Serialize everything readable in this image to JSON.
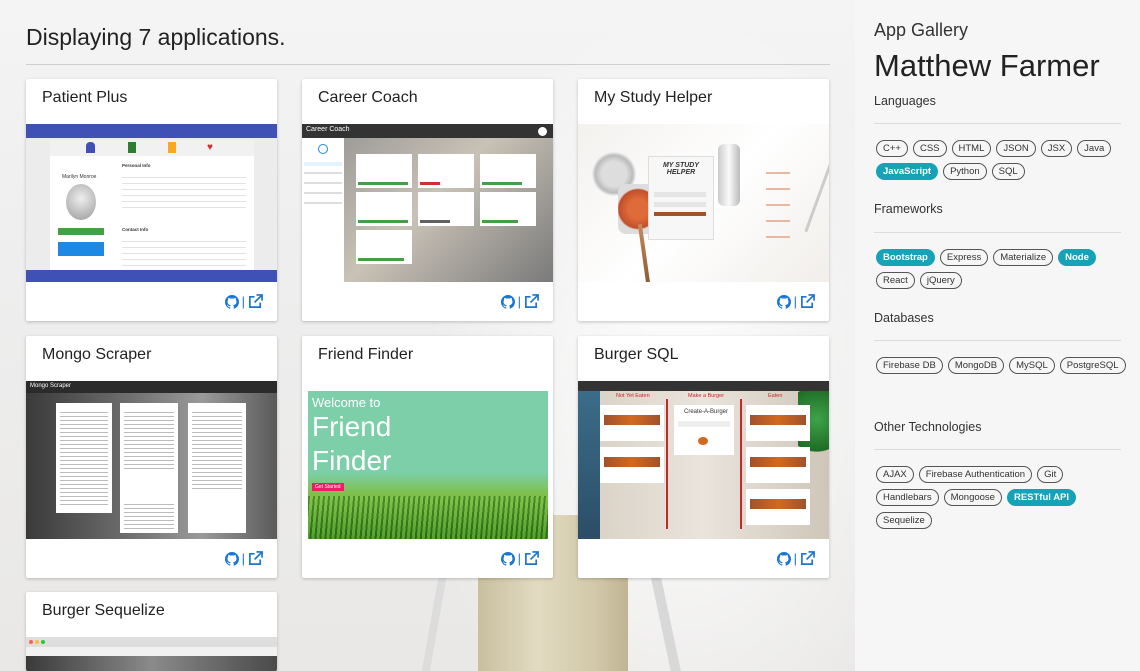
{
  "main": {
    "heading": "Displaying 7 applications."
  },
  "cards": [
    {
      "title": "Patient Plus",
      "thumb_text": [
        "Marilyn Monroe",
        "Personal Info",
        "Contact Info",
        "Add a New Snapshot",
        "Schedule an Appointment"
      ]
    },
    {
      "title": "Career Coach",
      "thumb_text": [
        "Career Coach"
      ]
    },
    {
      "title": "My Study Helper",
      "thumb_text": [
        "MY STUDY HELPER"
      ]
    },
    {
      "title": "Mongo Scraper",
      "thumb_text": [
        "Mongo Scraper"
      ]
    },
    {
      "title": "Friend Finder",
      "thumb_text": [
        "Welcome to",
        "Friend",
        "Finder",
        "Get Started"
      ]
    },
    {
      "title": "Burger SQL",
      "thumb_text": [
        "Not Yet Eaten",
        "Make a Burger",
        "Eaten",
        "Create-A-Burger"
      ]
    },
    {
      "title": "Burger Sequelize"
    }
  ],
  "action_separator": "|",
  "sidebar": {
    "subtitle": "App Gallery",
    "name": "Matthew Farmer",
    "sections": [
      {
        "title": "Languages",
        "chips": [
          {
            "label": "C++",
            "highlight": false
          },
          {
            "label": "CSS",
            "highlight": false
          },
          {
            "label": "HTML",
            "highlight": false
          },
          {
            "label": "JSON",
            "highlight": false
          },
          {
            "label": "JSX",
            "highlight": false
          },
          {
            "label": "Java",
            "highlight": false
          },
          {
            "label": "JavaScript",
            "highlight": true
          },
          {
            "label": "Python",
            "highlight": false
          },
          {
            "label": "SQL",
            "highlight": false
          }
        ]
      },
      {
        "title": "Frameworks",
        "chips": [
          {
            "label": "Bootstrap",
            "highlight": true
          },
          {
            "label": "Express",
            "highlight": false
          },
          {
            "label": "Materialize",
            "highlight": false
          },
          {
            "label": "Node",
            "highlight": true
          },
          {
            "label": "React",
            "highlight": false
          },
          {
            "label": "jQuery",
            "highlight": false
          }
        ]
      },
      {
        "title": "Databases",
        "chips": [
          {
            "label": "Firebase DB",
            "highlight": false
          },
          {
            "label": "MongoDB",
            "highlight": false
          },
          {
            "label": "MySQL",
            "highlight": false
          },
          {
            "label": "PostgreSQL",
            "highlight": false
          }
        ]
      },
      {
        "title": "Other Technologies",
        "chips": [
          {
            "label": "AJAX",
            "highlight": false
          },
          {
            "label": "Firebase Authentication",
            "highlight": false
          },
          {
            "label": "Git",
            "highlight": false
          },
          {
            "label": "Handlebars",
            "highlight": false
          },
          {
            "label": "Mongoose",
            "highlight": false
          },
          {
            "label": "RESTful API",
            "highlight": true
          },
          {
            "label": "Sequelize",
            "highlight": false
          }
        ]
      }
    ]
  },
  "colors": {
    "accent": "#17a2b8",
    "icon_blue": "#1976d2"
  }
}
